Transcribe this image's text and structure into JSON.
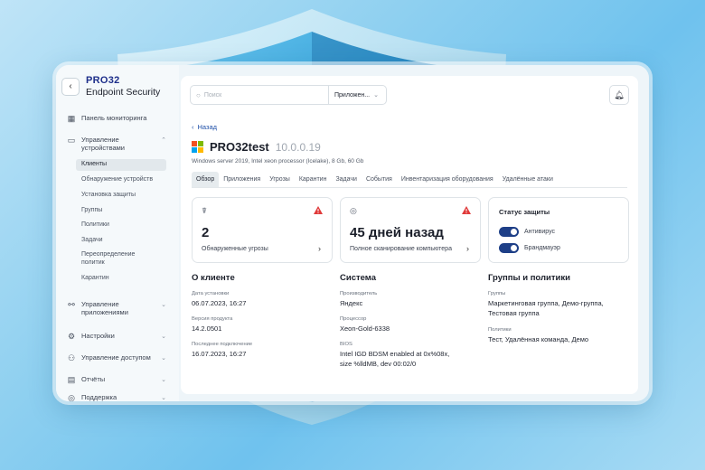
{
  "colors": {
    "accent": "#1e3f87",
    "link": "#1e4fa8",
    "warning": "#e03a3a",
    "toggle_on": "#1e3f87"
  },
  "app": {
    "logo": "PRO32",
    "name": "Endpoint Security"
  },
  "sidebar": {
    "items": [
      {
        "label": "Панель мониторинга",
        "icon": "dashboard-icon"
      },
      {
        "label": "Управление устройствами",
        "icon": "monitor-icon"
      },
      {
        "label": "Управление приложениями",
        "icon": "apps-icon"
      },
      {
        "label": "Настройки",
        "icon": "gear-icon"
      },
      {
        "label": "Управление доступом",
        "icon": "users-icon"
      },
      {
        "label": "Отчёты",
        "icon": "reports-icon"
      },
      {
        "label": "Поддержка",
        "icon": "support-icon"
      }
    ],
    "subitems": [
      {
        "label": "Клиенты",
        "active": true
      },
      {
        "label": "Обнаружение устройств"
      },
      {
        "label": "Установка защиты"
      },
      {
        "label": "Группы"
      },
      {
        "label": "Политики"
      },
      {
        "label": "Задачи"
      },
      {
        "label": "Переопределение политик"
      },
      {
        "label": "Карантин"
      }
    ]
  },
  "header": {
    "search_placeholder": "Поиск",
    "search_scope": "Приложен..."
  },
  "page": {
    "back": "Назад",
    "hostname": "PRO32test",
    "ip": "10.0.0.19",
    "subtitle": "Windows server 2019, Intel xeon processor (Icelake), 8 Gb, 60 Gb",
    "tabs": [
      "Обзор",
      "Приложения",
      "Угрозы",
      "Карантин",
      "Задачи",
      "События",
      "Инвентаризация оборудования",
      "Удалённые атаки"
    ],
    "active_tab": "Обзор"
  },
  "cards": {
    "threats": {
      "value": "2",
      "label": "Обнаруженные угрозы"
    },
    "scan": {
      "value": "45 дней назад",
      "label": "Полное сканирование компьютера"
    },
    "protection": {
      "title": "Статус защиты",
      "items": [
        {
          "label": "Антивирус",
          "on": true
        },
        {
          "label": "Брандмауэр",
          "on": true
        }
      ]
    }
  },
  "client": {
    "title": "О клиенте",
    "install_label": "Дата установки",
    "install_value": "06.07.2023, 16:27",
    "version_label": "Версия продукта",
    "version_value": "14.2.0501",
    "last_label": "Последнее подключение",
    "last_value": "16.07.2023, 16:27"
  },
  "system": {
    "title": "Система",
    "maker_label": "Производитель",
    "maker_value": "Яндекс",
    "cpu_label": "Процессор",
    "cpu_value": "Xeon-Gold-6338",
    "bios_label": "BIOS",
    "bios_value_1": "Intel IGD BDSM enabled at 0x%08x,",
    "bios_value_2": "size %lldMB, dev 00:02/0"
  },
  "groups": {
    "title": "Группы и политики",
    "groups_label": "Группы",
    "groups_value_1": "Маркетинговая группа, Демо-группа,",
    "groups_value_2": "Тестовая группа",
    "policies_label": "Политики",
    "policies_value": "Тест, Удалённая команда, Демо"
  }
}
